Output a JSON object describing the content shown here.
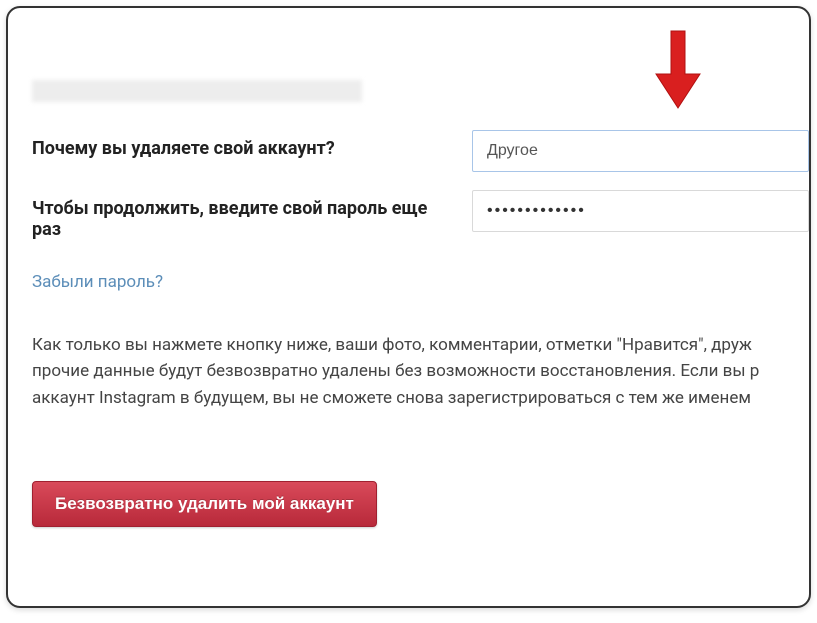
{
  "form": {
    "reasonLabel": "Почему вы удаляете свой аккаунт?",
    "reasonValue": "Другое",
    "passwordLabel": "Чтобы продолжить, введите свой пароль еще раз",
    "passwordValue": "•••••••••••••",
    "forgotPassword": "Забыли пароль?"
  },
  "warning": "Как только вы нажмете кнопку ниже, ваши фото, комментарии, отметки \"Нравится\", друж прочие данные будут безвозвратно удалены без возможности восстановления. Если вы р аккаунт Instagram в будущем, вы не сможете снова зарегистрироваться с тем же именем",
  "buttons": {
    "delete": "Безвозвратно удалить мой аккаунт"
  }
}
